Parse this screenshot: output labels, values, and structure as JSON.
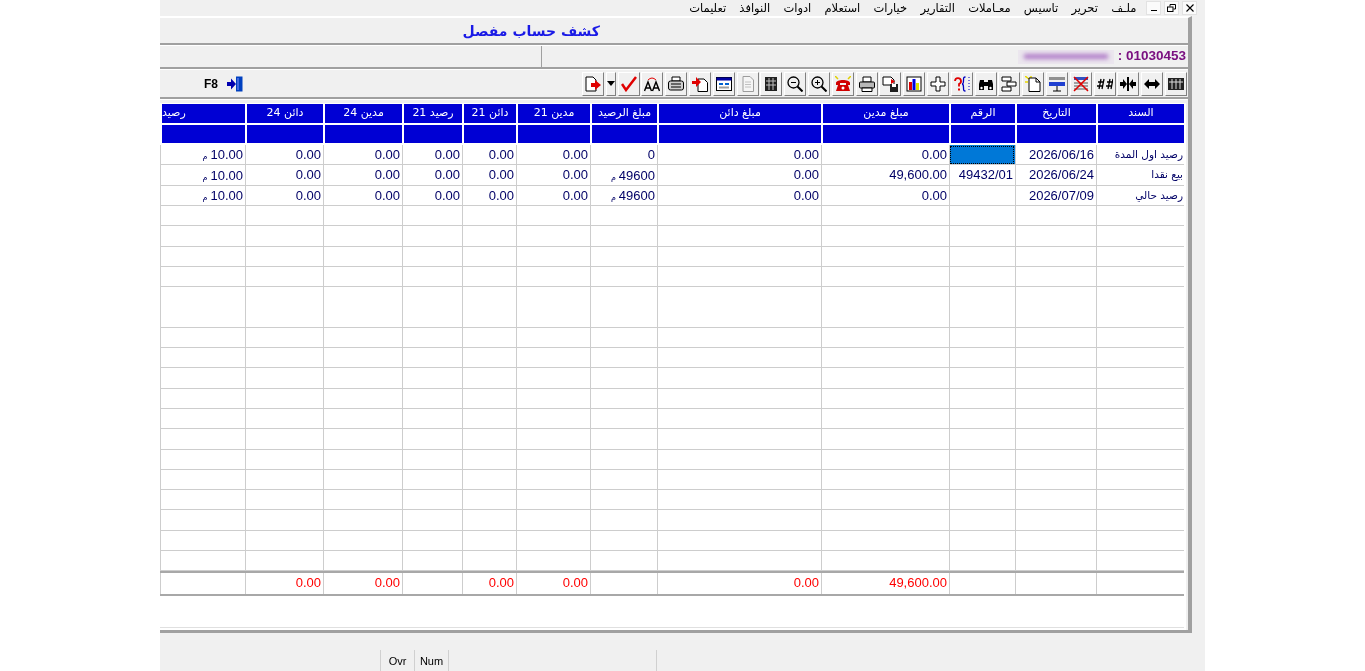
{
  "menu_bar": {
    "items": [
      "ملـف",
      "تحرير",
      "تاسيس",
      "معـاملات",
      "التقارير",
      "خيارات",
      "استعلام",
      "ادوات",
      "النوافذ",
      "تعليمات"
    ]
  },
  "window": {
    "title": "كشف حساب مفصل"
  },
  "account": {
    "number": "01030453 :",
    "name_blurred": true
  },
  "toolbar": {
    "buttons": [
      {
        "kind": "button",
        "disabled": false
      },
      {
        "kind": "button",
        "disabled": false
      },
      {
        "kind": "button",
        "disabled": false
      },
      {
        "kind": "button",
        "disabled": false
      },
      {
        "kind": "button",
        "disabled": false
      },
      {
        "kind": "button",
        "disabled": false
      },
      {
        "kind": "button",
        "disabled": false
      },
      {
        "kind": "button",
        "disabled": false
      },
      {
        "kind": "button",
        "disabled": false
      },
      {
        "kind": "button",
        "disabled": false
      },
      {
        "kind": "button",
        "disabled": false
      },
      {
        "kind": "button",
        "disabled": false
      },
      {
        "kind": "button",
        "disabled": false
      },
      {
        "kind": "button",
        "disabled": false
      },
      {
        "kind": "button",
        "disabled": false
      },
      {
        "kind": "button",
        "disabled": false
      },
      {
        "kind": "button",
        "disabled": false
      },
      {
        "kind": "button",
        "disabled": false
      },
      {
        "kind": "button",
        "disabled": true
      },
      {
        "kind": "button",
        "disabled": false
      },
      {
        "kind": "button",
        "disabled": false
      },
      {
        "kind": "button",
        "disabled": false
      },
      {
        "kind": "button",
        "disabled": false
      },
      {
        "kind": "button",
        "disabled": false
      },
      {
        "kind": "dropdown",
        "disabled": false
      },
      {
        "kind": "button",
        "disabled": false
      }
    ],
    "exit_shortcut": "F8"
  },
  "table": {
    "columns": [
      "السند",
      "التاريخ",
      "الرقم",
      "مبلغ مدين",
      "مبلغ دائن",
      "مبلغ الرصيد",
      "مدين 21",
      "دائن 21",
      "رصيد 21",
      "مدين 24",
      "دائن 24",
      "رصيد"
    ],
    "rows": [
      {
        "cells": [
          {
            "text": "رصيد اول المدة",
            "selected": false
          },
          {
            "text": "2026/06/16",
            "selected": false
          },
          {
            "selected": true
          },
          {
            "text": "0.00",
            "selected": false
          },
          {
            "text": "0.00",
            "selected": false
          },
          {
            "text": "0",
            "selected": false
          },
          {
            "text": "0.00",
            "selected": false
          },
          {
            "text": "0.00",
            "selected": false
          },
          {
            "text": "0.00",
            "selected": false
          },
          {
            "text": "0.00",
            "selected": false
          },
          {
            "text": "0.00",
            "selected": false
          },
          {
            "text": "10.00",
            "unit": "م",
            "selected": false
          }
        ]
      },
      {
        "cells": [
          {
            "text": "بيع نقدا",
            "selected": false
          },
          {
            "text": "2026/06/24",
            "selected": false
          },
          {
            "text": "49432/01",
            "selected": false
          },
          {
            "text": "49,600.00",
            "selected": false
          },
          {
            "text": "0.00",
            "selected": false
          },
          {
            "text": "49600",
            "unit": "م",
            "selected": false
          },
          {
            "text": "0.00",
            "selected": false
          },
          {
            "text": "0.00",
            "selected": false
          },
          {
            "text": "0.00",
            "selected": false
          },
          {
            "text": "0.00",
            "selected": false
          },
          {
            "text": "0.00",
            "selected": false
          },
          {
            "text": "10.00",
            "unit": "م",
            "selected": false
          }
        ]
      },
      {
        "cells": [
          {
            "text": "رصيد حالي",
            "selected": false
          },
          {
            "text": "2026/07/09",
            "selected": false
          },
          {
            "selected": false
          },
          {
            "text": "0.00",
            "selected": false
          },
          {
            "text": "0.00",
            "selected": false
          },
          {
            "text": "49600",
            "unit": "م",
            "selected": false
          },
          {
            "text": "0.00",
            "selected": false
          },
          {
            "text": "0.00",
            "selected": false
          },
          {
            "text": "0.00",
            "selected": false
          },
          {
            "text": "0.00",
            "selected": false
          },
          {
            "text": "0.00",
            "selected": false
          },
          {
            "text": "10.00",
            "unit": "م",
            "selected": false
          }
        ]
      }
    ],
    "totals": [
      {
        "kind": "blank"
      },
      {
        "kind": "blank"
      },
      {
        "kind": "blank"
      },
      {
        "kind": "value",
        "text": "49,600.00"
      },
      {
        "kind": "value",
        "text": "0.00"
      },
      {
        "kind": "blank"
      },
      {
        "kind": "value",
        "text": "0.00"
      },
      {
        "kind": "value",
        "text": "0.00"
      },
      {
        "kind": "blank"
      },
      {
        "kind": "value",
        "text": "0.00"
      },
      {
        "kind": "value",
        "text": "0.00"
      },
      {
        "kind": "blank"
      }
    ]
  },
  "status_bar": {
    "panels": [
      "Num",
      "Ovr"
    ]
  }
}
